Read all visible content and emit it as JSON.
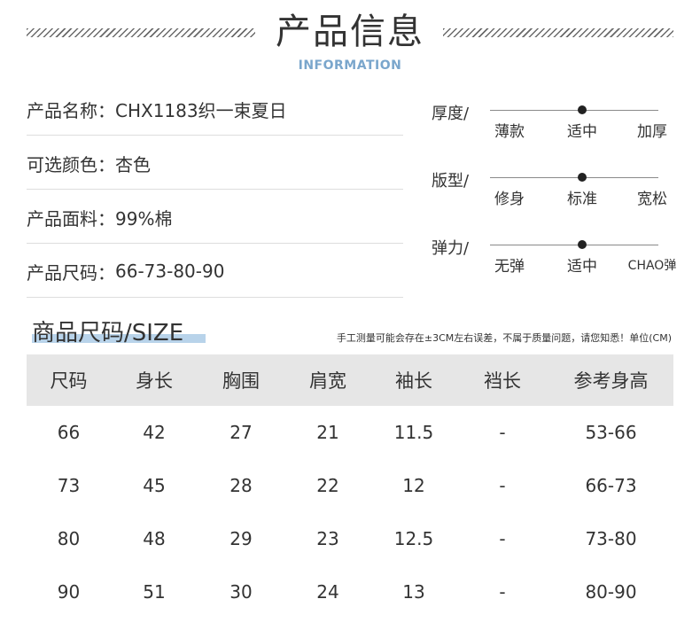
{
  "header": {
    "title": "产品信息",
    "subtitle": "INFORMATION"
  },
  "info": [
    {
      "label": "产品名称：",
      "value": "CHX1183织一束夏日"
    },
    {
      "label": "可选颜色：",
      "value": "杏色"
    },
    {
      "label": "产品面料：",
      "value": "99%棉"
    },
    {
      "label": "产品尺码：",
      "value": "66-73-80-90"
    }
  ],
  "scales": [
    {
      "label": "厚度/",
      "options": [
        "薄款",
        "适中",
        "加厚"
      ],
      "selected_index": 1
    },
    {
      "label": "版型/",
      "options": [
        "修身",
        "标准",
        "宽松"
      ],
      "selected_index": 1
    },
    {
      "label": "弹力/",
      "options": [
        "无弹",
        "适中",
        "CHAO弹"
      ],
      "selected_index": 1
    }
  ],
  "size_section": {
    "title": "商品尺码/SIZE",
    "note": "手工测量可能会存在±3CM左右误差，不属于质量问题，请您知悉！单位(CM)"
  },
  "size_table": {
    "headers": [
      "尺码",
      "身长",
      "胸围",
      "肩宽",
      "袖长",
      "裆长",
      "参考身高"
    ],
    "rows": [
      [
        "66",
        "42",
        "27",
        "21",
        "11.5",
        "-",
        "53-66"
      ],
      [
        "73",
        "45",
        "28",
        "22",
        "12",
        "-",
        "66-73"
      ],
      [
        "80",
        "48",
        "29",
        "23",
        "12.5",
        "-",
        "73-80"
      ],
      [
        "90",
        "51",
        "30",
        "24",
        "13",
        "-",
        "80-90"
      ]
    ]
  }
}
